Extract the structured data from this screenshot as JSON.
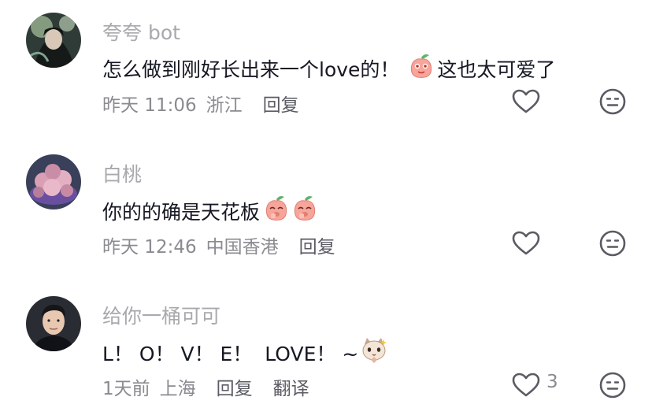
{
  "comments": [
    {
      "username": "夸夸 bot",
      "text_before": "怎么做到刚好长出来一个love的！",
      "text_after": "这也太可爱了",
      "time": "昨天 11:06",
      "location": "浙江",
      "reply_label": "回复",
      "avatar_icon": "dark-anime-avatar",
      "like_icon": "heart-outline-icon",
      "dislike_icon": "meh-face-icon"
    },
    {
      "username": "白桃",
      "text_before": "你的的确是天花板",
      "time": "昨天 12:46",
      "location": "中国香港",
      "reply_label": "回复",
      "avatar_icon": "succulent-plant-avatar",
      "like_icon": "heart-outline-icon",
      "dislike_icon": "meh-face-icon"
    },
    {
      "username": "给你一桶可可",
      "text_before": "L！ O！ V！ E！  LOVE！ ~",
      "time": "1天前",
      "location": "上海",
      "reply_label": "回复",
      "translate_label": "翻译",
      "like_count": "3",
      "avatar_icon": "man-portrait-avatar",
      "like_icon": "heart-outline-icon",
      "dislike_icon": "meh-face-icon"
    }
  ],
  "colors": {
    "username": "#a8a9ad",
    "text": "#161823",
    "meta": "#8a8b91",
    "icon_stroke": "#5a5b63",
    "peach": "#f7a49a"
  }
}
